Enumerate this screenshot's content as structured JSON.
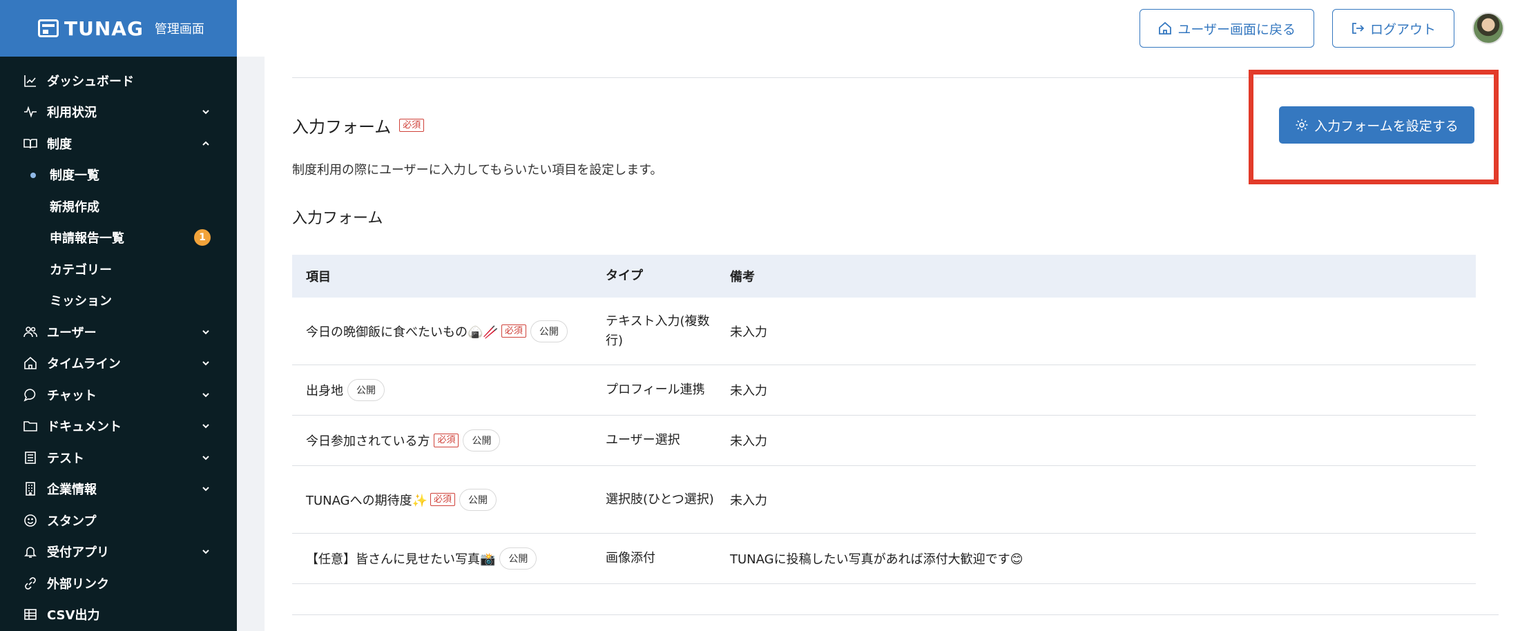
{
  "brand": {
    "name": "TUNAG",
    "subtitle": "管理画面"
  },
  "sidebar": {
    "items": [
      {
        "label": "ダッシュボード",
        "icon": "chart-icon",
        "chevron": ""
      },
      {
        "label": "利用状況",
        "icon": "activity-icon",
        "chevron": "down"
      },
      {
        "label": "制度",
        "icon": "book-icon",
        "chevron": "up"
      },
      {
        "label": "ユーザー",
        "icon": "users-icon",
        "chevron": "down"
      },
      {
        "label": "タイムライン",
        "icon": "home-icon",
        "chevron": "down"
      },
      {
        "label": "チャット",
        "icon": "chat-icon",
        "chevron": "down"
      },
      {
        "label": "ドキュメント",
        "icon": "folder-icon",
        "chevron": "down"
      },
      {
        "label": "テスト",
        "icon": "list-icon",
        "chevron": "down"
      },
      {
        "label": "企業情報",
        "icon": "building-icon",
        "chevron": "down"
      },
      {
        "label": "スタンプ",
        "icon": "smile-icon",
        "chevron": ""
      },
      {
        "label": "受付アプリ",
        "icon": "bell-icon",
        "chevron": "down"
      },
      {
        "label": "外部リンク",
        "icon": "link-icon",
        "chevron": ""
      },
      {
        "label": "CSV出力",
        "icon": "table-icon",
        "chevron": ""
      }
    ],
    "subitems": [
      {
        "label": "制度一覧",
        "active": true
      },
      {
        "label": "新規作成"
      },
      {
        "label": "申請報告一覧",
        "badge": "1"
      },
      {
        "label": "カテゴリー"
      },
      {
        "label": "ミッション"
      }
    ]
  },
  "header": {
    "back_button": "ユーザー画面に戻る",
    "logout_button": "ログアウト"
  },
  "main": {
    "section_title": "入力フォーム",
    "required_label": "必須",
    "public_label": "公開",
    "description": "制度利用の際にユーザーに入力してもらいたい項目を設定します。",
    "sub_title": "入力フォーム",
    "config_button": "入力フォームを設定する",
    "table": {
      "headers": [
        "項目",
        "タイプ",
        "備考"
      ],
      "rows": [
        {
          "item": "今日の晩御飯に食べたいもの🍙🥢",
          "required": true,
          "public": true,
          "type": "テキスト入力(複数行)",
          "note": "未入力"
        },
        {
          "item": "出身地",
          "required": false,
          "public": true,
          "type": "プロフィール連携",
          "note": "未入力"
        },
        {
          "item": "今日参加されている方",
          "required": true,
          "public": true,
          "type": "ユーザー選択",
          "note": "未入力"
        },
        {
          "item": "TUNAGへの期待度✨",
          "required": true,
          "public": true,
          "type": "選択肢(ひとつ選択)",
          "note": "未入力"
        },
        {
          "item": "【任意】皆さんに見せたい写真📸",
          "required": false,
          "public": true,
          "type": "画像添付",
          "note": "TUNAGに投稿したい写真があれば添付大歓迎です😊"
        }
      ]
    }
  },
  "colors": {
    "brand": "#3578c0",
    "sidebar_bg": "#0b1e24",
    "highlight": "#e23b2a",
    "required": "#d0423a"
  }
}
